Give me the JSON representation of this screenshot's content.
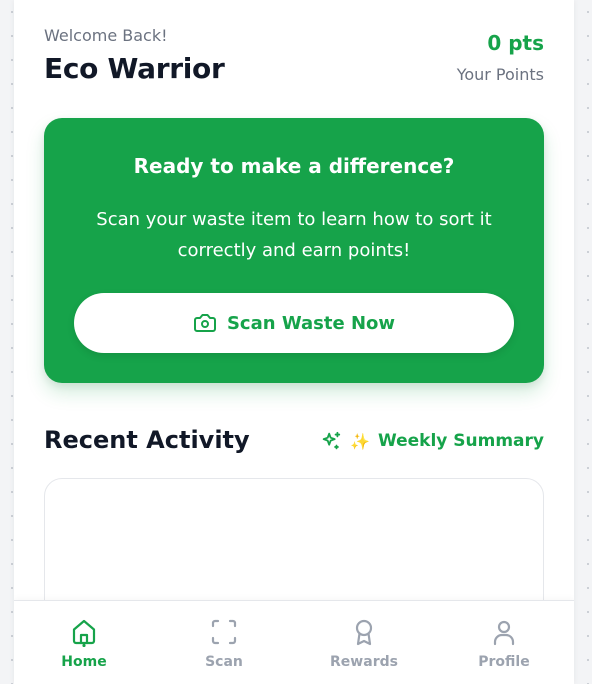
{
  "header": {
    "welcome": "Welcome Back!",
    "username": "Eco Warrior",
    "points_value": "0 pts",
    "points_label": "Your Points"
  },
  "hero": {
    "title": "Ready to make a difference?",
    "subtitle": "Scan your waste item to learn how to sort it correctly and earn points!",
    "button_label": "Scan Waste Now",
    "button_icon": "camera-icon"
  },
  "activity": {
    "title": "Recent Activity",
    "summary_emoji": "✨",
    "summary_label": "Weekly Summary",
    "summary_icon": "sparkles-icon"
  },
  "nav": {
    "items": [
      {
        "label": "Home",
        "icon": "home-icon",
        "active": true
      },
      {
        "label": "Scan",
        "icon": "scan-icon",
        "active": false
      },
      {
        "label": "Rewards",
        "icon": "award-icon",
        "active": false
      },
      {
        "label": "Profile",
        "icon": "user-icon",
        "active": false
      }
    ]
  },
  "colors": {
    "brand_green": "#16a34a",
    "text_dark": "#111827",
    "text_muted": "#6b7280",
    "nav_inactive": "#9ca3af"
  }
}
